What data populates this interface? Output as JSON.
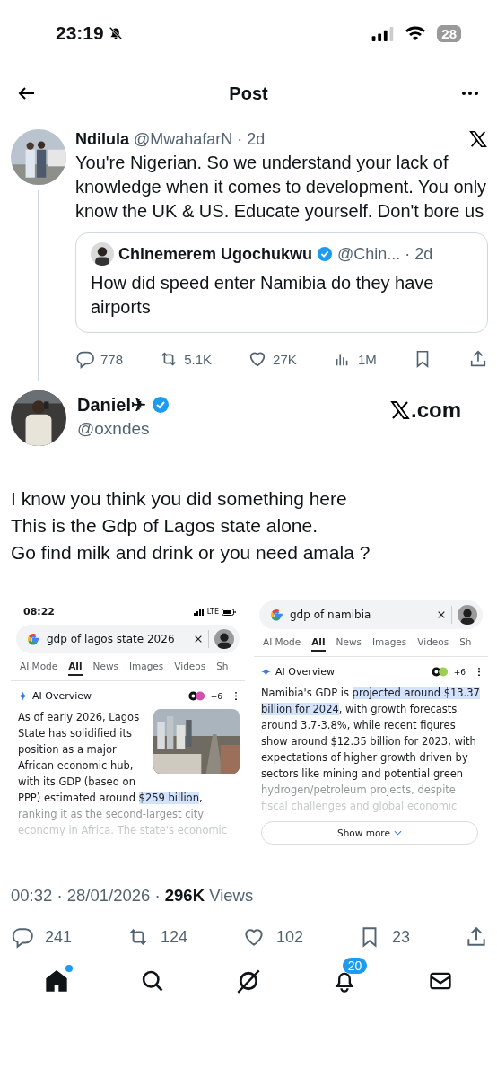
{
  "status_bar": {
    "time": "23:19",
    "muted": true,
    "battery": "28"
  },
  "header": {
    "title": "Post"
  },
  "reply_card": {
    "author": {
      "name": "Ndilula",
      "handle": "@MwahafarN",
      "time": "· 2d",
      "verified": false
    },
    "text": "You're Nigerian. So we understand your lack of knowledge when it comes to development. You only know the UK & US. Educate yourself. Don't bore us",
    "quote": {
      "name": "Chinemerem Ugochukwu",
      "verified": true,
      "handle": "@Chin...",
      "time": "· 2d",
      "text": "How did speed enter Namibia do they have airports"
    },
    "stats": [
      {
        "kind": "reply",
        "count": "778"
      },
      {
        "kind": "repost",
        "count": "5.1K"
      },
      {
        "kind": "like",
        "count": "27K"
      },
      {
        "kind": "views",
        "count": "1M"
      },
      {
        "kind": "bookmark"
      },
      {
        "kind": "share"
      }
    ]
  },
  "post": {
    "author": {
      "name": "Daniel✈",
      "verified": true,
      "handle": "@oxndes",
      "site": ".com"
    },
    "lines": [
      "I know you think you did something here",
      "This is the Gdp of Lagos state alone.",
      "Go find milk and drink or you need amala ?"
    ],
    "screenshots": [
      {
        "status_time": "08:22",
        "network": "LTE",
        "query": "gdp of lagos state 2026",
        "tabs": [
          {
            "label": "AI Mode",
            "selected": false
          },
          {
            "label": "All",
            "selected": true
          },
          {
            "label": "News",
            "selected": false
          },
          {
            "label": "Images",
            "selected": false
          },
          {
            "label": "Videos",
            "selected": false
          },
          {
            "label": "Sh",
            "selected": false
          }
        ],
        "overview_title": "AI Overview",
        "sources_more": "+6",
        "has_picture": true,
        "text_before": "As of early 2026, Lagos State has solidified its position as a major African economic hub, with its GDP (based on PPP) estimated around ",
        "highlight": "$259 billion",
        "text_after": ",",
        "faded_lines": [
          "ranking it as the second-largest city",
          "economy in Africa. The state's economic"
        ]
      },
      {
        "query": "gdp of namibia",
        "tabs": [
          {
            "label": "AI Mode",
            "selected": false
          },
          {
            "label": "All",
            "selected": true
          },
          {
            "label": "News",
            "selected": false
          },
          {
            "label": "Images",
            "selected": false
          },
          {
            "label": "Videos",
            "selected": false
          },
          {
            "label": "Sh",
            "selected": false
          }
        ],
        "overview_title": "AI Overview",
        "sources_more": "+6",
        "has_picture": false,
        "text_before": "Namibia's GDP is ",
        "highlight": "projected around $13.37 billion for 2024",
        "text_after": ", with growth forecasts around 3.7-3.8%, while recent figures show around $12.35 billion for 2023, with expectations of higher growth driven by sectors like mining and potential green",
        "faded_lines": [
          "hydrogen/petroleum projects, despite",
          "fiscal challenges and global economic"
        ],
        "show_more": "Show more"
      }
    ]
  },
  "meta": "00:32 · 28/01/2026 · **296K** Views",
  "stats": [
    {
      "kind": "reply",
      "count": "241"
    },
    {
      "kind": "repost",
      "count": "124"
    },
    {
      "kind": "like",
      "count": "102"
    },
    {
      "kind": "bookmark",
      "count": "23"
    },
    {
      "kind": "share"
    }
  ],
  "nav": [
    {
      "kind": "home",
      "selected": true,
      "dot": true
    },
    {
      "kind": "search",
      "selected": false,
      "dot": false
    },
    {
      "kind": "grok",
      "selected": false,
      "dot": false
    },
    {
      "kind": "bell",
      "selected": false,
      "dot": false,
      "badge": "20"
    },
    {
      "kind": "mail",
      "selected": false,
      "dot": false
    }
  ]
}
